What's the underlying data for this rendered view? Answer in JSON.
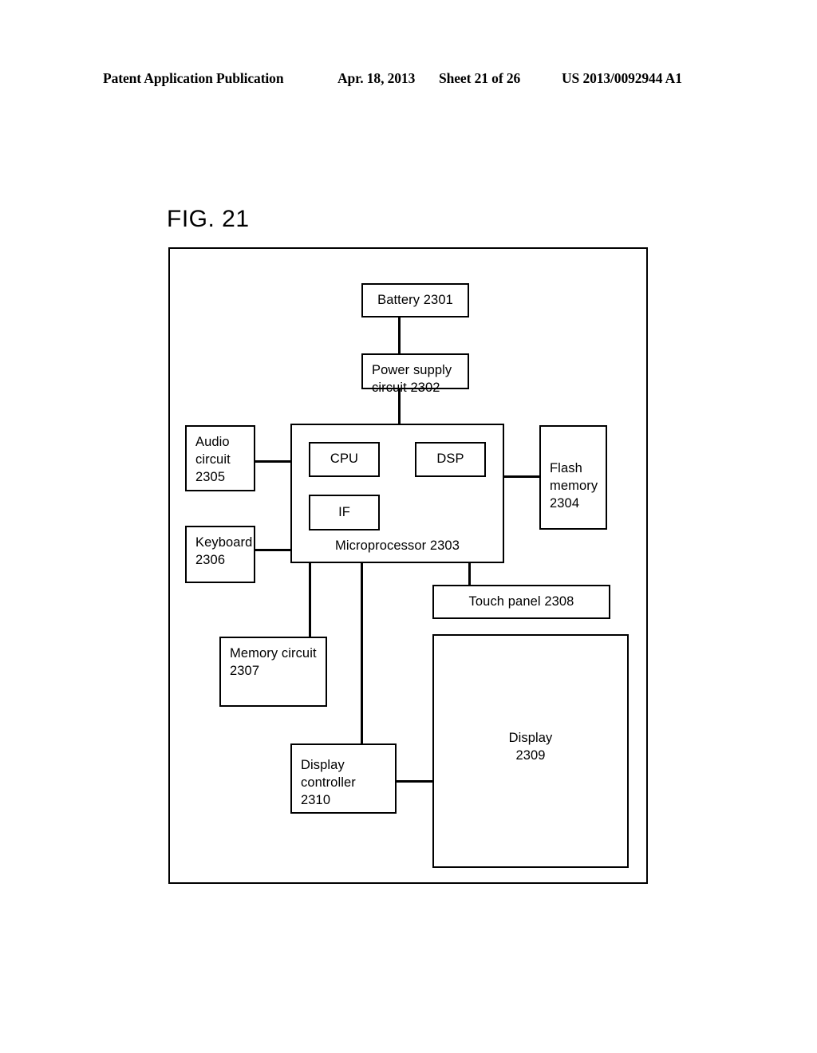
{
  "header": {
    "publication": "Patent Application Publication",
    "date": "Apr. 18, 2013",
    "sheet": "Sheet 21 of 26",
    "patent_number": "US 2013/0092944 A1"
  },
  "figure": {
    "label": "FIG. 21",
    "nodes": {
      "battery": "Battery 2301",
      "power_supply": "Power supply\ncircuit 2302",
      "microprocessor": "Microprocessor 2303",
      "cpu": "CPU",
      "dsp": "DSP",
      "if": "IF",
      "flash_memory": "Flash\nmemory\n2304",
      "audio_circuit": "Audio\ncircuit\n2305",
      "keyboard": "Keyboard\n2306",
      "memory_circuit": "Memory circuit\n2307",
      "touch_panel": "Touch panel 2308",
      "display": "Display\n2309",
      "display_controller": "Display\ncontroller\n2310"
    },
    "colors": {
      "line": "#000000",
      "fill": "#ffffff",
      "text": "#000000"
    }
  }
}
